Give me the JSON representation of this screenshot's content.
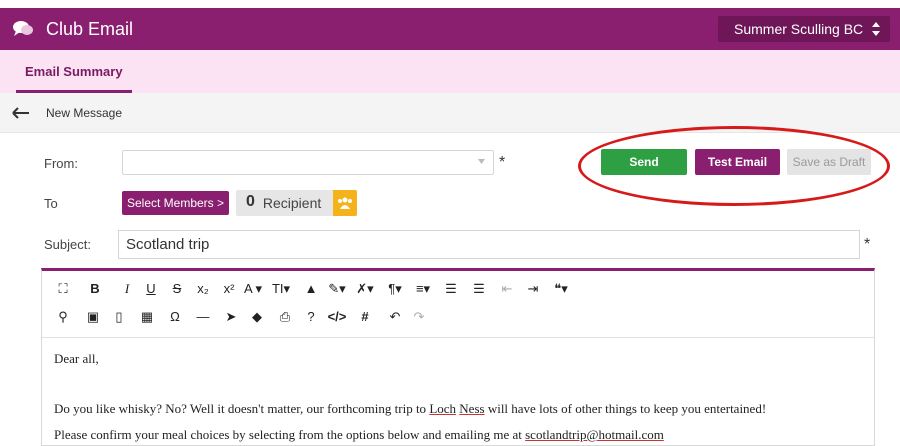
{
  "app": {
    "title": "Club Email",
    "club": "Summer Sculling BC"
  },
  "tabs": [
    {
      "label": "Email Summary",
      "active": true
    }
  ],
  "message_bar": {
    "label": "New Message"
  },
  "form": {
    "from_label": "From:",
    "from_value": "",
    "to_label": "To",
    "select_members_label": "Select Members  >",
    "recipient_count": "0",
    "recipient_label": "Recipient",
    "subject_label": "Subject:",
    "subject_value": "Scotland trip",
    "required_mark": "*"
  },
  "actions": {
    "send": "Send",
    "test_email": "Test Email",
    "save_draft": "Save as Draft"
  },
  "toolbar": {
    "row1": [
      {
        "name": "fullscreen-icon",
        "glyph": "⛶"
      },
      {
        "name": "bold-button",
        "glyph": "B"
      },
      {
        "name": "italic-button",
        "glyph": "I"
      },
      {
        "name": "underline-button",
        "glyph": "U"
      },
      {
        "name": "strikethrough-button",
        "glyph": "S"
      },
      {
        "name": "subscript-button",
        "glyph": "x₂"
      },
      {
        "name": "superscript-button",
        "glyph": "x²"
      },
      {
        "name": "font-family-button",
        "glyph": "A ▾"
      },
      {
        "name": "font-size-button",
        "glyph": "TI▾"
      },
      {
        "name": "text-color-icon",
        "glyph": "▲"
      },
      {
        "name": "brush-icon",
        "glyph": "✎▾"
      },
      {
        "name": "clear-format-icon",
        "glyph": "✗▾"
      },
      {
        "name": "paragraph-format-button",
        "glyph": "¶▾"
      },
      {
        "name": "align-button",
        "glyph": "≡▾"
      },
      {
        "name": "ordered-list-button",
        "glyph": "☰"
      },
      {
        "name": "unordered-list-button",
        "glyph": "☰"
      },
      {
        "name": "outdent-button",
        "glyph": "⇤"
      },
      {
        "name": "indent-button",
        "glyph": "⇥"
      },
      {
        "name": "quote-button",
        "glyph": "❝▾"
      }
    ],
    "row2": [
      {
        "name": "link-icon",
        "glyph": "⚲"
      },
      {
        "name": "image-icon",
        "glyph": "▣"
      },
      {
        "name": "file-icon",
        "glyph": "▯"
      },
      {
        "name": "table-icon",
        "glyph": "▦"
      },
      {
        "name": "special-char-icon",
        "glyph": "Ω"
      },
      {
        "name": "horizontal-line-icon",
        "glyph": "—"
      },
      {
        "name": "select-all-icon",
        "glyph": "➤"
      },
      {
        "name": "eraser-icon",
        "glyph": "◆"
      },
      {
        "name": "print-icon",
        "glyph": "⎙"
      },
      {
        "name": "help-icon",
        "glyph": "?"
      },
      {
        "name": "code-view-icon",
        "glyph": "</>"
      },
      {
        "name": "hash-icon",
        "glyph": "#"
      },
      {
        "name": "undo-icon",
        "glyph": "↶"
      },
      {
        "name": "redo-icon",
        "glyph": "↷"
      }
    ]
  },
  "body": {
    "greeting": "Dear all,",
    "line1_pre": "Do you like whisky? No? Well it doesn't matter, our forthcoming trip to ",
    "line1_loch": "Loch",
    "line1_ness": "Ness",
    "line1_post": " will have lots of other things to keep you entertained!",
    "line2_pre": "Please confirm your meal choices by selecting from the options below and emailing me at ",
    "line2_email": "scotlandtrip@hotmail.com"
  },
  "colors": {
    "brand": "#8a1f6f",
    "send": "#2ea043",
    "highlight": "#d61a1a",
    "group": "#f5b31b"
  }
}
